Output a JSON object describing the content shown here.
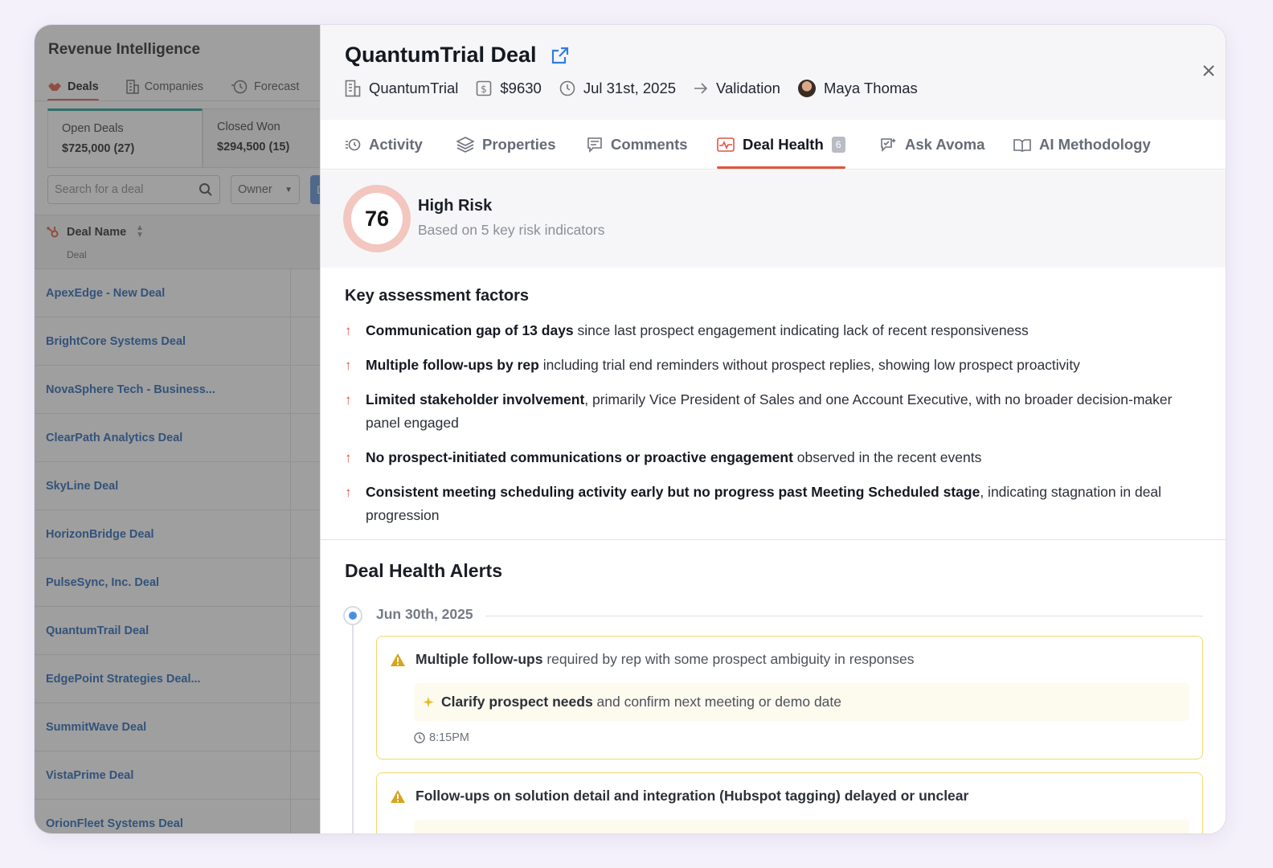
{
  "left": {
    "app_title": "Revenue Intelligence",
    "tabs": [
      {
        "label": "Deals"
      },
      {
        "label": "Companies"
      },
      {
        "label": "Forecast"
      }
    ],
    "deal_tabs": [
      {
        "label": "Open Deals",
        "amount": "$725,000 (27)"
      },
      {
        "label": "Closed Won",
        "amount": "$294,500 (15)"
      }
    ],
    "search_placeholder": "Search for a deal",
    "owner_label": "Owner",
    "d_button": "D",
    "column": {
      "title": "Deal Name",
      "subtitle": "Deal"
    },
    "deals": [
      "ApexEdge - New Deal",
      "BrightCore Systems Deal",
      "NovaSphere Tech - Business...",
      "ClearPath Analytics Deal",
      "SkyLine Deal",
      "HorizonBridge Deal",
      "PulseSync, Inc. Deal",
      "QuantumTrail Deal",
      "EdgePoint Strategies Deal...",
      "SummitWave Deal",
      "VistaPrime Deal",
      "OrionFleet Systems Deal"
    ]
  },
  "panel": {
    "title": "QuantumTrial Deal",
    "meta": {
      "company": "QuantumTrial",
      "amount": "$9630",
      "date": "Jul 31st, 2025",
      "stage": "Validation",
      "owner": "Maya Thomas"
    },
    "tabs": [
      {
        "label": "Activity"
      },
      {
        "label": "Properties"
      },
      {
        "label": "Comments"
      },
      {
        "label": "Deal Health",
        "badge": "6"
      },
      {
        "label": "Ask Avoma"
      },
      {
        "label": "AI Methodology"
      }
    ],
    "score": {
      "value": "76",
      "level": "High Risk",
      "subtitle": "Based on 5 key risk indicators"
    },
    "factors_title": "Key assessment factors",
    "factors": [
      {
        "bold": "Communication gap of 13 days",
        "rest": " since last prospect engagement indicating lack of recent responsiveness"
      },
      {
        "bold": "Multiple follow-ups by rep",
        "rest": " including trial end reminders without prospect replies, showing low prospect proactivity"
      },
      {
        "bold": "Limited stakeholder involvement",
        "rest": ", primarily Vice President of Sales and one Account Executive, with no broader decision-maker panel engaged"
      },
      {
        "bold": "No prospect-initiated communications or proactive engagement",
        "rest": " observed in the recent events"
      },
      {
        "bold": "Consistent meeting scheduling activity early but no progress past Meeting Scheduled stage",
        "rest": ", indicating stagnation in deal progression"
      }
    ],
    "alerts_title": "Deal Health Alerts",
    "alert_date": "Jun 30th, 2025",
    "alerts": [
      {
        "bold": "Multiple follow-ups",
        "rest": " required by rep with some prospect ambiguity in responses",
        "suggest_bold": "Clarify prospect needs",
        "suggest_rest": " and confirm next meeting or demo date",
        "time": "8:15PM"
      },
      {
        "bold": "Follow-ups on solution detail and integration (Hubspot tagging) delayed or unclear",
        "rest": ""
      }
    ]
  },
  "colors": {
    "accent": "#e2543c",
    "link": "#1f5fb4",
    "alert_border": "#f2d86c",
    "score_ring": "#f3c6c0"
  }
}
